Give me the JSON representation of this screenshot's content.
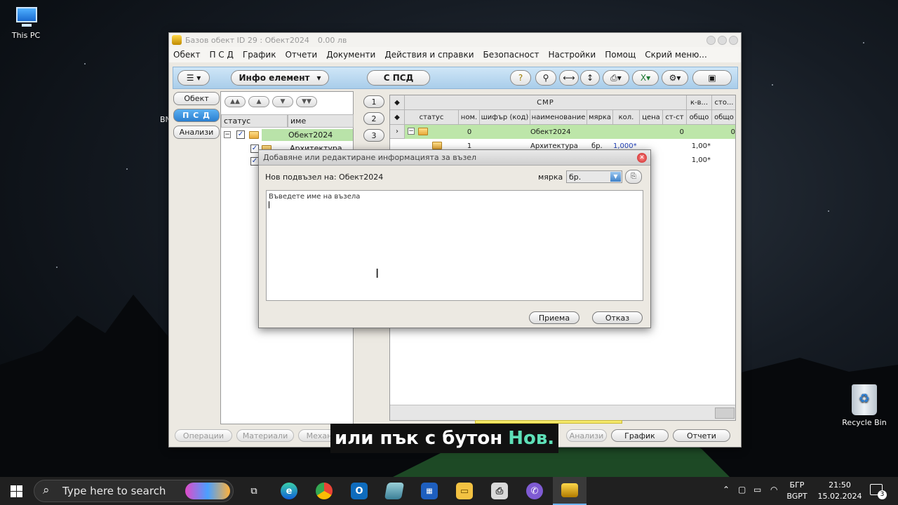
{
  "desktop": {
    "this_pc_label": "This PC",
    "recycle_bin_label": "Recycle Bin",
    "partial_left_label": "BN"
  },
  "window": {
    "title": "Базов обект ID 29 : Обект2024",
    "title_amount": "0.00 лв"
  },
  "menu": [
    "Обект",
    "П С Д",
    "График",
    "Отчети",
    "Документи",
    "Действия и справки",
    "Безопасност",
    "Настройки",
    "Помощ",
    "Скрий меню..."
  ],
  "toolbar": {
    "info_element": "Инфо елемент",
    "psd_refresh": "С ПСД"
  },
  "side_tabs": [
    "Обект",
    "П С Д",
    "Анализи"
  ],
  "left_tree": {
    "col_status": "статус",
    "col_name": "име",
    "rows": [
      "Обект2024",
      "Архитектура"
    ]
  },
  "level_buttons": [
    "1",
    "2",
    "3"
  ],
  "grid": {
    "group_smr": "СМР",
    "group_kv": "к-в...",
    "group_sto": "сто...",
    "columns": [
      "статус",
      "ном.",
      "шифър (код)",
      "наименование",
      "мярка",
      "кол.",
      "цена",
      "ст-ст",
      "общо",
      "общо"
    ],
    "rows": [
      {
        "num": "0",
        "name": "Обект2024",
        "unit": "",
        "qty": "",
        "cost": "0",
        "total1": "",
        "total2": "0"
      },
      {
        "num": "1",
        "name": "Архитектура",
        "unit": "бр.",
        "qty": "1,000*",
        "cost": "",
        "total1": "1,00*",
        "total2": ""
      },
      {
        "num": "",
        "name": "",
        "unit": "",
        "qty": "",
        "cost": "",
        "total1": "1,00*",
        "total2": ""
      }
    ]
  },
  "bottom_tabs": [
    "Операции",
    "Материали",
    "Механ",
    "Анализи",
    "График",
    "Отчети"
  ],
  "dialog": {
    "title": "Добавяне или редактиране информацията за възел",
    "parent_label": "Нов подвъзел на: Обект2024",
    "unit_label": "мярка",
    "unit_value": "бр.",
    "name_placeholder": "Въведете име на възела",
    "ok": "Приема",
    "cancel": "Отказ"
  },
  "subtitle": {
    "text": "или пък с бутон ",
    "highlight": "Нов."
  },
  "taskbar": {
    "search_placeholder": "Type here to search",
    "lang_top": "БГР",
    "lang_bottom": "BGPT",
    "time": "21:50",
    "date": "15.02.2024",
    "notifications": "3"
  }
}
